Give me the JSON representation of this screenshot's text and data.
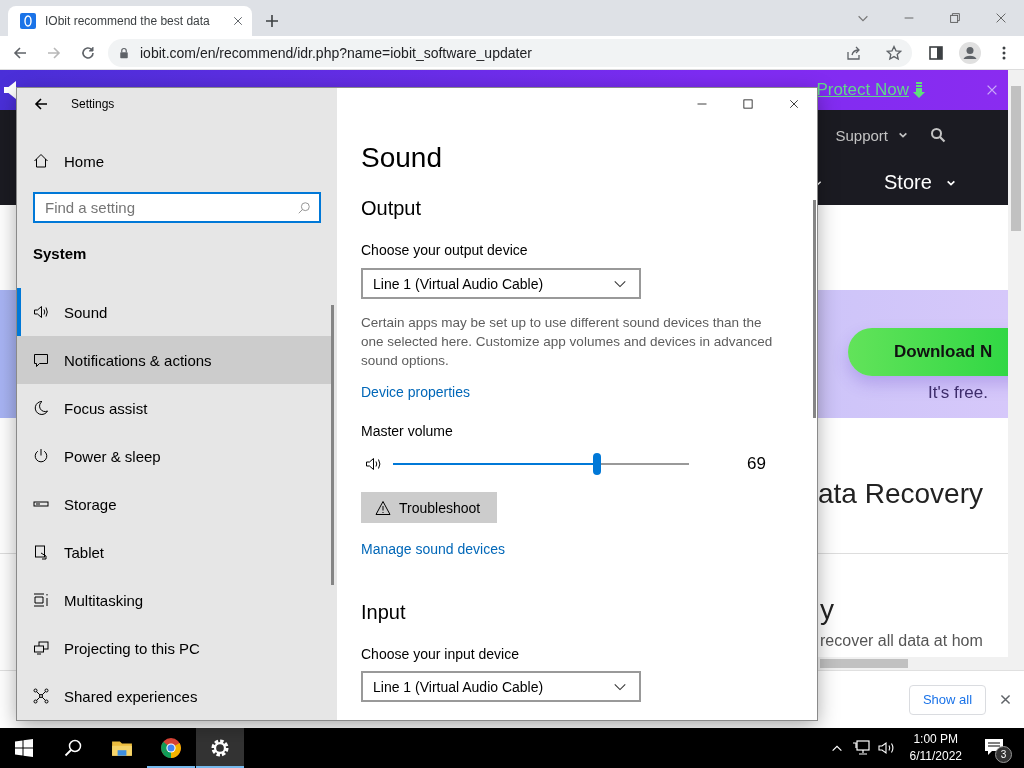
{
  "browser": {
    "tab": {
      "title": "IObit recommend the best data",
      "selected": true
    },
    "url": "iobit.com/en/recommend/idr.php?name=iobit_software_updater"
  },
  "web_page": {
    "banner": {
      "link": "Protect Now"
    },
    "nav": {
      "top_item": "Support",
      "main_item": "Store"
    },
    "promo": {
      "button": "Download N",
      "note": "It's free."
    },
    "sections": [
      {
        "title": "ata Recovery"
      },
      {
        "title": "y",
        "text": "recover all data at hom"
      }
    ]
  },
  "download_bar": {
    "button": "Show all"
  },
  "settings": {
    "title": "Settings",
    "home": "Home",
    "search": {
      "placeholder": "Find a setting"
    },
    "group": "System",
    "items": [
      {
        "label": "Sound",
        "selected": true,
        "hovered": false
      },
      {
        "label": "Notifications & actions",
        "selected": false,
        "hovered": true
      },
      {
        "label": "Focus assist",
        "selected": false,
        "hovered": false
      },
      {
        "label": "Power & sleep",
        "selected": false,
        "hovered": false
      },
      {
        "label": "Storage",
        "selected": false,
        "hovered": false
      },
      {
        "label": "Tablet",
        "selected": false,
        "hovered": false
      },
      {
        "label": "Multitasking",
        "selected": false,
        "hovered": false
      },
      {
        "label": "Projecting to this PC",
        "selected": false,
        "hovered": false
      },
      {
        "label": "Shared experiences",
        "selected": false,
        "hovered": false
      }
    ],
    "page": {
      "title": "Sound",
      "output": {
        "heading": "Output",
        "device_label": "Choose your output device",
        "device": "Line 1 (Virtual Audio Cable)",
        "note": "Certain apps may be set up to use different sound devices than the one selected here. Customize app volumes and devices in advanced sound options.",
        "link": "Device properties",
        "volume_label": "Master volume",
        "volume": {
          "level": 0.69,
          "reading": "69"
        },
        "troubleshoot": "Troubleshoot",
        "manage_link": "Manage sound devices"
      },
      "input": {
        "heading": "Input",
        "device_label": "Choose your input device",
        "device": "Line 1 (Virtual Audio Cable)"
      }
    }
  },
  "taskbar": {
    "apps": [
      {
        "running": false,
        "active": false
      },
      {
        "running": true,
        "active": false
      },
      {
        "running": true,
        "active": true
      }
    ],
    "time": "1:00 PM",
    "date": "6/11/2022",
    "notifications": "3"
  }
}
